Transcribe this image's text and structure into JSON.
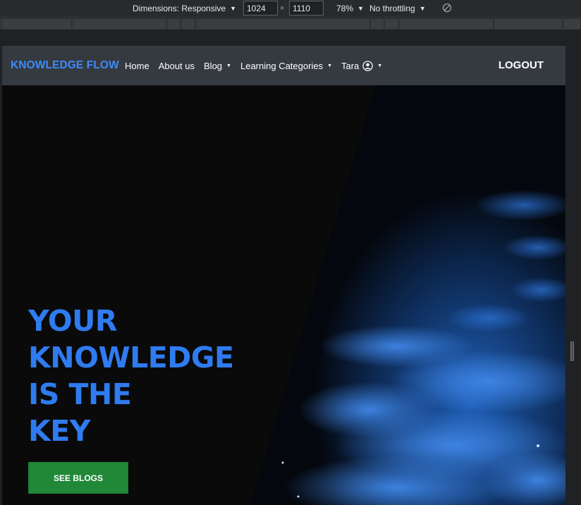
{
  "devtools": {
    "dimensions_label": "Dimensions: Responsive",
    "width_value": "1024",
    "height_value": "1110",
    "times_symbol": "×",
    "zoom_label": "78%",
    "throttle_label": "No throttling",
    "caret_icon": "caret-down-icon",
    "rotate_icon": "rotate-icon"
  },
  "nav": {
    "brand": "KNOWLEDGE FLOW",
    "items": [
      {
        "label": "Home"
      },
      {
        "label": "About us"
      },
      {
        "label": "Blog"
      },
      {
        "label": "Learning Categories"
      },
      {
        "label": "Tara"
      }
    ],
    "logout_label": "LOGOUT",
    "user_icon": "user-circle-icon"
  },
  "hero": {
    "title_lines": [
      "YOUR",
      "KNOWLEDGE",
      "IS THE",
      "KEY"
    ],
    "cta_label": "SEE BLOGS"
  },
  "colors": {
    "brand_blue": "#3d8bfd",
    "title_blue": "#2f7bf0",
    "navbar_bg": "#343a40",
    "cta_green": "#218838"
  }
}
